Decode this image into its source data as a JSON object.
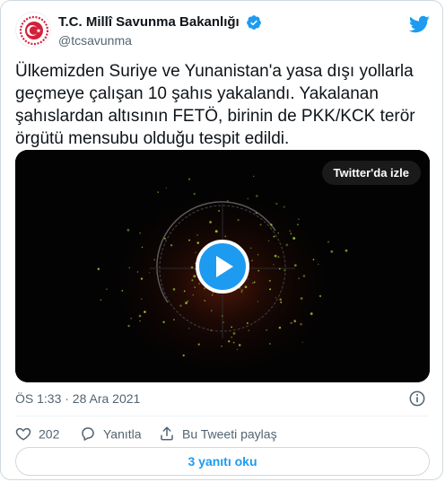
{
  "author": {
    "display_name": "T.C. Millî Savunma Bakanlığı",
    "handle": "@tcsavunma",
    "verified": true
  },
  "tweet": {
    "text": "Ülkemizden Suriye ve Yunanistan'a yasa dışı yollarla geçmeye çalışan 10 şahıs yakalandı. Yakalanan şahıslardan altısının FETÖ, birinin de PKK/KCK terör örgütü mensubu olduğu tespit edildi.",
    "timestamp": "ÖS 1:33 · 28 Ara 2021"
  },
  "video": {
    "watch_label": "Twitter'da izle"
  },
  "actions": {
    "like_count": "202",
    "reply_label": "Yanıtla",
    "share_label": "Bu Tweeti paylaş"
  },
  "replies_button": "3 yanıtı oku",
  "icons": {
    "brand": "twitter-bird-icon",
    "verified": "verified-badge-icon",
    "info": "info-icon",
    "like": "heart-icon",
    "reply": "speech-bubble-icon",
    "share": "share-icon",
    "play": "play-icon"
  },
  "colors": {
    "accent": "#1d9bf0",
    "text_primary": "#0f1419",
    "text_secondary": "#536471",
    "border": "#cfd9de",
    "logo_red": "#d3203a"
  }
}
